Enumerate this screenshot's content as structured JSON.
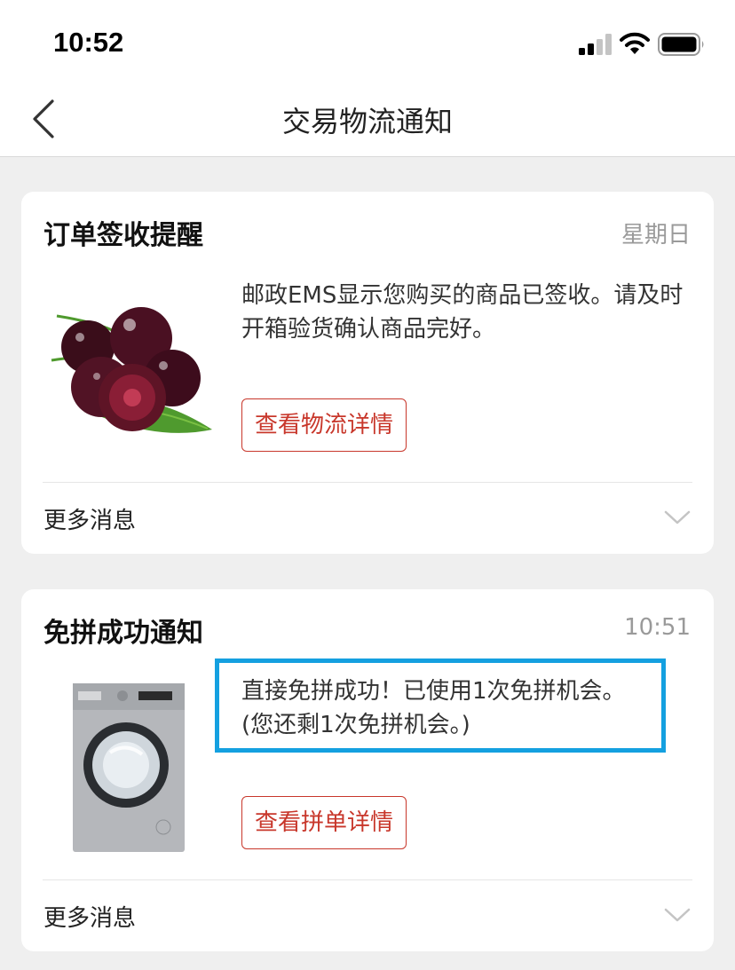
{
  "status_bar": {
    "time": "10:52",
    "icons": [
      "signal-icon",
      "wifi-icon",
      "battery-icon"
    ]
  },
  "nav": {
    "title": "交易物流通知",
    "back_icon": "chevron-left-icon"
  },
  "cards": [
    {
      "title": "订单签收提醒",
      "time": "星期日",
      "image": "cherries",
      "message": "邮政EMS显示您购买的商品已签收。请及时开箱验货确认商品完好。",
      "button_label": "查看物流详情",
      "more_label": "更多消息"
    },
    {
      "title": "免拼成功通知",
      "time": "10:51",
      "image": "washing-machine",
      "message_line1": "直接免拼成功！已使用1次免拼机会。",
      "message_line2": "(您还剩1次免拼机会。)",
      "button_label": "查看拼单详情",
      "more_label": "更多消息"
    }
  ],
  "colors": {
    "accent_red": "#c8372b",
    "highlight_blue": "#14a0e0",
    "background": "#efefef"
  }
}
